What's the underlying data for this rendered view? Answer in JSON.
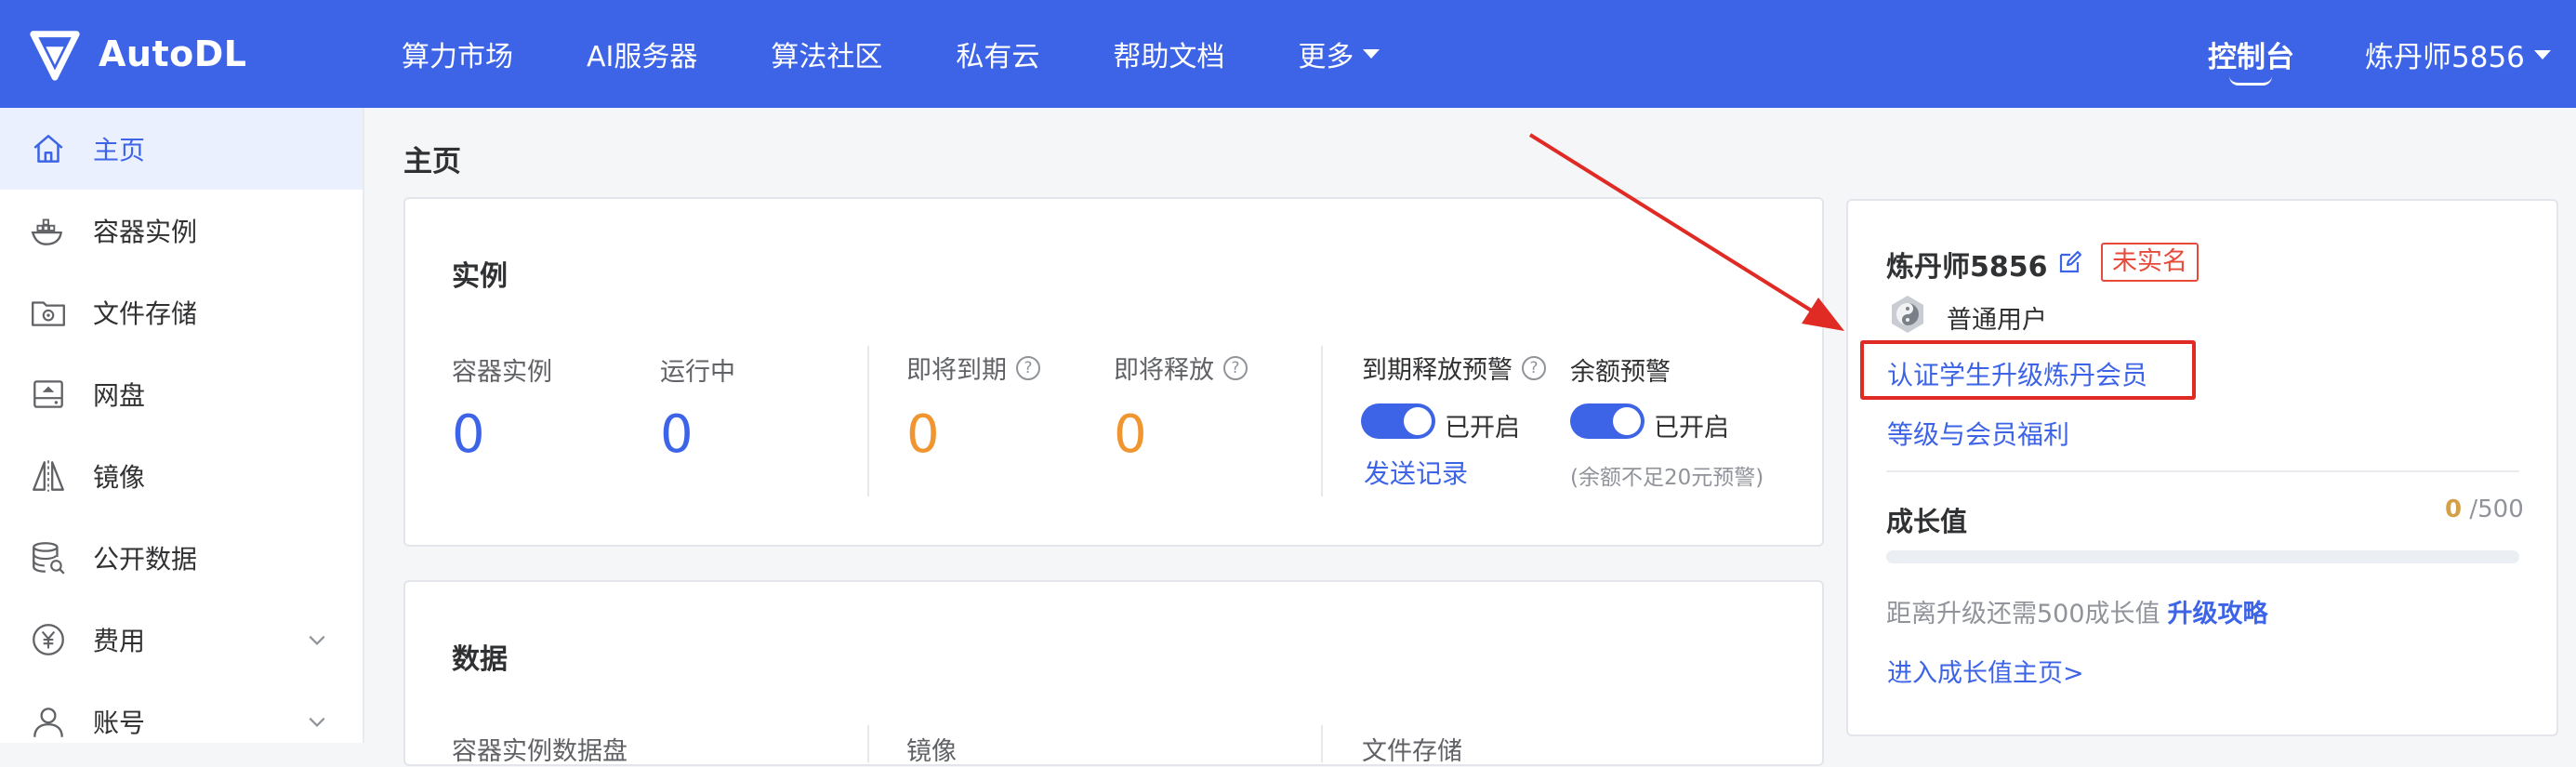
{
  "brand": {
    "name": "AutoDL"
  },
  "nav": {
    "items": [
      "算力市场",
      "AI服务器",
      "算法社区",
      "私有云",
      "帮助文档",
      "更多"
    ],
    "console": "控制台",
    "user": "炼丹师5856"
  },
  "sidebar": {
    "items": [
      {
        "label": "主页",
        "icon": "home-icon",
        "active": true
      },
      {
        "label": "容器实例",
        "icon": "container-icon"
      },
      {
        "label": "文件存储",
        "icon": "storage-icon"
      },
      {
        "label": "网盘",
        "icon": "disk-icon"
      },
      {
        "label": "镜像",
        "icon": "image-icon"
      },
      {
        "label": "公开数据",
        "icon": "database-icon"
      },
      {
        "label": "费用",
        "icon": "yuan-icon",
        "expandable": true
      },
      {
        "label": "账号",
        "icon": "user-icon",
        "expandable": true
      }
    ]
  },
  "page": {
    "title": "主页"
  },
  "instances": {
    "title": "实例",
    "container_label": "容器实例",
    "container_value": "0",
    "running_label": "运行中",
    "running_value": "0",
    "expiring_label": "即将到期",
    "expiring_value": "0",
    "releasing_label": "即将释放",
    "releasing_value": "0",
    "release_warn_label": "到期释放预警",
    "balance_warn_label": "余额预警",
    "release_toggle_text": "已开启",
    "balance_toggle_text": "已开启",
    "send_log": "发送记录",
    "balance_hint": "(余额不足20元预警)"
  },
  "data_card": {
    "title": "数据",
    "col1": "容器实例数据盘",
    "col2": "镜像",
    "col3": "文件存储"
  },
  "profile": {
    "username": "炼丹师5856",
    "badge": "未实名",
    "role": "普通用户",
    "student_link": "认证学生升级炼丹会员",
    "benefits_link": "等级与会员福利",
    "growth_title": "成长值",
    "growth_current": "0",
    "growth_max": "/500",
    "growth_fraction": 0,
    "upgrade_hint": "距离升级还需500成长值",
    "upgrade_link": "升级攻略",
    "growth_home_link": "进入成长值主页>"
  },
  "colors": {
    "primary": "#3d64e6",
    "accent": "#f0952f",
    "highlight": "#e02b25",
    "gold": "#d4a047"
  }
}
